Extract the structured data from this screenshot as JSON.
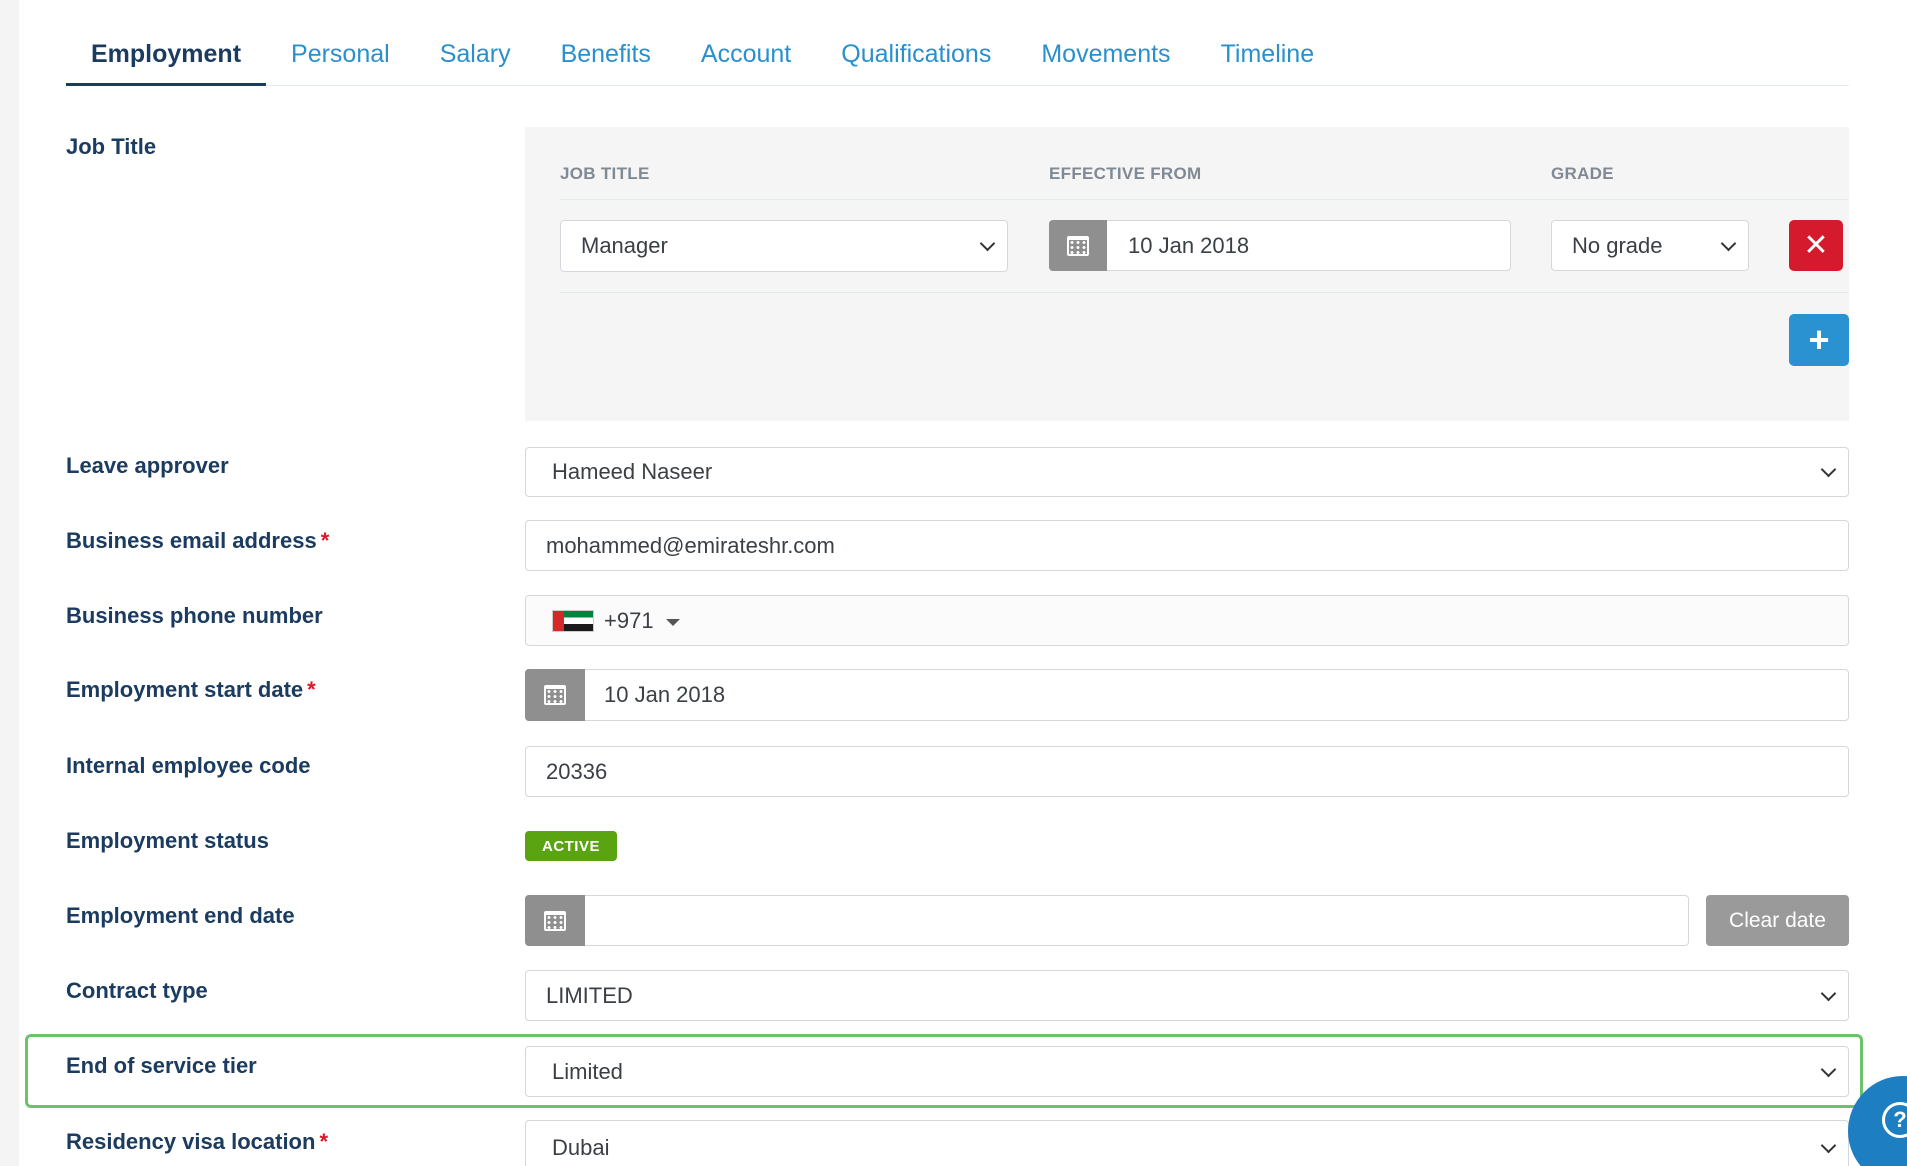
{
  "tabs": [
    {
      "label": "Employment",
      "active": true
    },
    {
      "label": "Personal"
    },
    {
      "label": "Salary"
    },
    {
      "label": "Benefits"
    },
    {
      "label": "Account"
    },
    {
      "label": "Qualifications"
    },
    {
      "label": "Movements"
    },
    {
      "label": "Timeline"
    }
  ],
  "job_title": {
    "label": "Job Title",
    "col_job_title": "JOB TITLE",
    "col_effective_from": "EFFECTIVE FROM",
    "col_grade": "GRADE",
    "row": {
      "job_title": "Manager",
      "effective_from": "10 Jan 2018",
      "grade": "No grade"
    },
    "delete_icon": "close-icon",
    "add_icon": "plus-icon"
  },
  "leave_approver": {
    "label": "Leave approver",
    "value": "Hameed Naseer"
  },
  "business_email": {
    "label": "Business email address",
    "required": "*",
    "value": "mohammed@emirateshr.com"
  },
  "business_phone": {
    "label": "Business phone number",
    "country_code": "+971",
    "flag": "uae-flag-icon"
  },
  "employment_start": {
    "label": "Employment start date",
    "required": "*",
    "value": "10 Jan 2018"
  },
  "internal_code": {
    "label": "Internal employee code",
    "value": "20336"
  },
  "employment_status": {
    "label": "Employment status",
    "badge": "ACTIVE",
    "badge_color": "#5aa412"
  },
  "employment_end": {
    "label": "Employment end date",
    "value": "",
    "clear_label": "Clear date"
  },
  "contract_type": {
    "label": "Contract type",
    "value": "LIMITED"
  },
  "end_of_service": {
    "label": "End of service tier",
    "value": "Limited"
  },
  "residency_visa": {
    "label": "Residency visa location",
    "required": "*",
    "value": "Dubai"
  },
  "colors": {
    "link": "#2a8fcc",
    "heading": "#1b3c60",
    "danger": "#d51a2d",
    "primary": "#2a92d1",
    "highlight": "#6cc26a"
  }
}
